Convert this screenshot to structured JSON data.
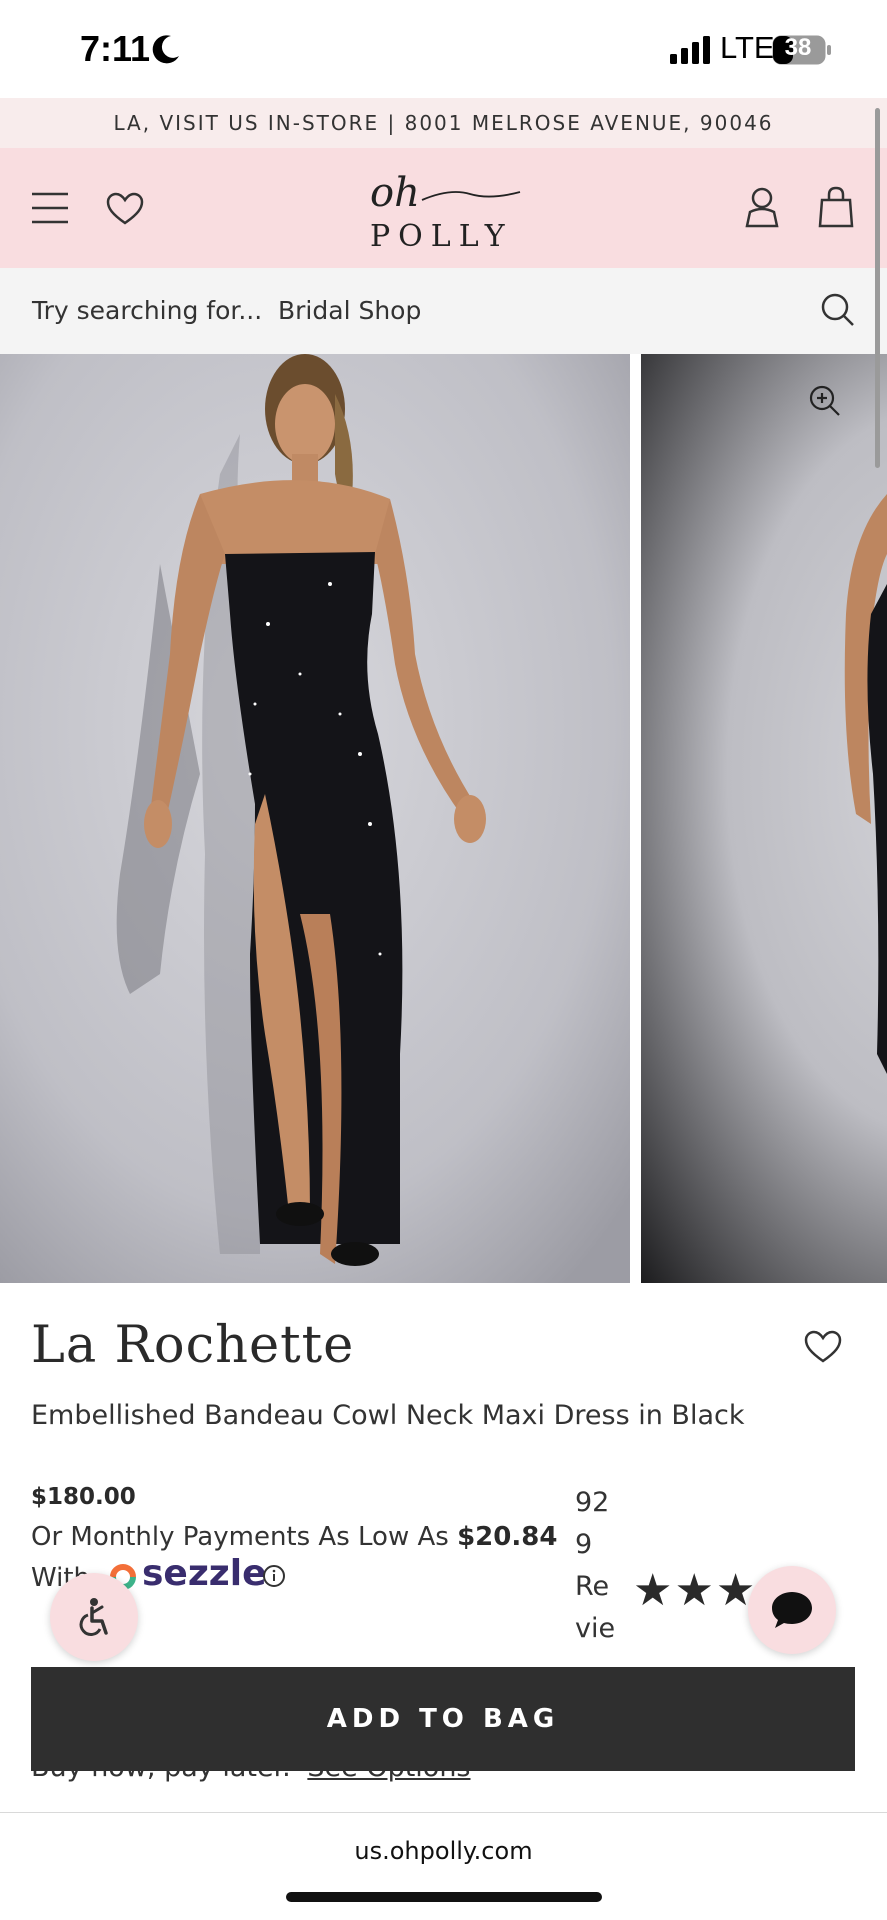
{
  "status_bar": {
    "time": "7:11",
    "network": "LTE",
    "battery": "38"
  },
  "announcement": "LA, VISIT US IN-STORE | 8001 MELROSE AVENUE, 90046",
  "header": {
    "logo_script": "oh",
    "logo_word": "POLLY",
    "icons": [
      "menu-icon",
      "heart-icon",
      "account-icon",
      "bag-icon"
    ]
  },
  "search": {
    "label": "Try searching for...",
    "suggestion": "Bridal Shop"
  },
  "product": {
    "name": "La Rochette",
    "description": "Embellished Bandeau Cowl Neck Maxi Dress in Black",
    "price": "$180.00",
    "monthly_prefix": "Or Monthly Payments As Low As",
    "monthly_amount": "$20.84",
    "with_text": "With",
    "provider": "sezzle",
    "review_count_lines": [
      "92",
      "9",
      "Re",
      "vie"
    ],
    "stars": "★★★",
    "rating_stars_shown": 3
  },
  "cta": {
    "add_to_bag": "ADD TO BAG",
    "buy_now_text": "Buy now, pay later.",
    "see_options": "See Options"
  },
  "browser": {
    "url": "us.ohpolly.com"
  },
  "colors": {
    "header_pink": "#f9dde0",
    "announcement_bg": "#f8ecec",
    "button_dark": "#2f2f2f",
    "sezzle_purple": "#392d6e"
  }
}
